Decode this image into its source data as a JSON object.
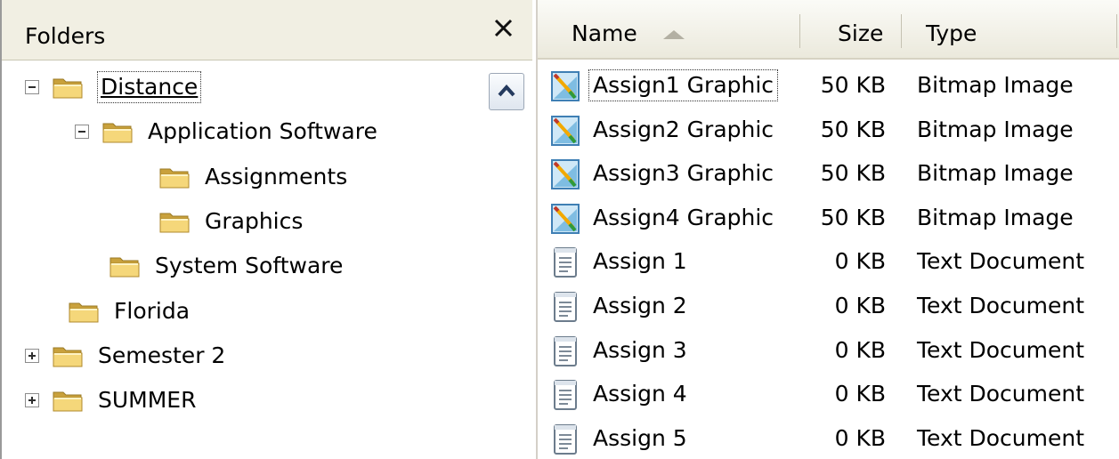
{
  "folders_pane": {
    "title": "Folders",
    "close_glyph": "✕",
    "tree": [
      {
        "label": "Distance",
        "level": 0,
        "expander": "minus",
        "selected": true
      },
      {
        "label": "Application Software",
        "level": 1,
        "expander": "minus",
        "selected": false
      },
      {
        "label": "Assignments",
        "level": 2,
        "expander": "none",
        "selected": false
      },
      {
        "label": "Graphics",
        "level": 2,
        "expander": "none",
        "selected": false
      },
      {
        "label": "System Software",
        "level": 1,
        "expander": "none",
        "selected": false
      },
      {
        "label": "Florida",
        "level": 0,
        "expander": "none",
        "selected": false
      },
      {
        "label": "Semester 2",
        "level": 0,
        "expander": "plus",
        "selected": false
      },
      {
        "label": "SUMMER",
        "level": 0,
        "expander": "plus",
        "selected": false
      }
    ]
  },
  "file_list": {
    "columns": {
      "name": "Name",
      "size": "Size",
      "type": "Type"
    },
    "sort_column": "Name",
    "sort_direction": "ascending",
    "rows": [
      {
        "name": "Assign1 Graphic",
        "size": "50 KB",
        "type": "Bitmap Image",
        "icon": "bitmap-image-icon",
        "focused": true
      },
      {
        "name": "Assign2 Graphic",
        "size": "50 KB",
        "type": "Bitmap Image",
        "icon": "bitmap-image-icon",
        "focused": false
      },
      {
        "name": "Assign3 Graphic",
        "size": "50 KB",
        "type": "Bitmap Image",
        "icon": "bitmap-image-icon",
        "focused": false
      },
      {
        "name": "Assign4 Graphic",
        "size": "50 KB",
        "type": "Bitmap Image",
        "icon": "bitmap-image-icon",
        "focused": false
      },
      {
        "name": "Assign 1",
        "size": "0 KB",
        "type": "Text Document",
        "icon": "text-document-icon",
        "focused": false
      },
      {
        "name": "Assign 2",
        "size": "0 KB",
        "type": "Text Document",
        "icon": "text-document-icon",
        "focused": false
      },
      {
        "name": "Assign 3",
        "size": "0 KB",
        "type": "Text Document",
        "icon": "text-document-icon",
        "focused": false
      },
      {
        "name": "Assign 4",
        "size": "0 KB",
        "type": "Text Document",
        "icon": "text-document-icon",
        "focused": false
      },
      {
        "name": "Assign 5",
        "size": "0 KB",
        "type": "Text Document",
        "icon": "text-document-icon",
        "focused": false
      }
    ]
  },
  "colors": {
    "folder_fill": "#f5d77a",
    "folder_dark": "#c9a13c",
    "header_bg": "#f1efe3",
    "scroll_arrow": "#243a5e"
  }
}
